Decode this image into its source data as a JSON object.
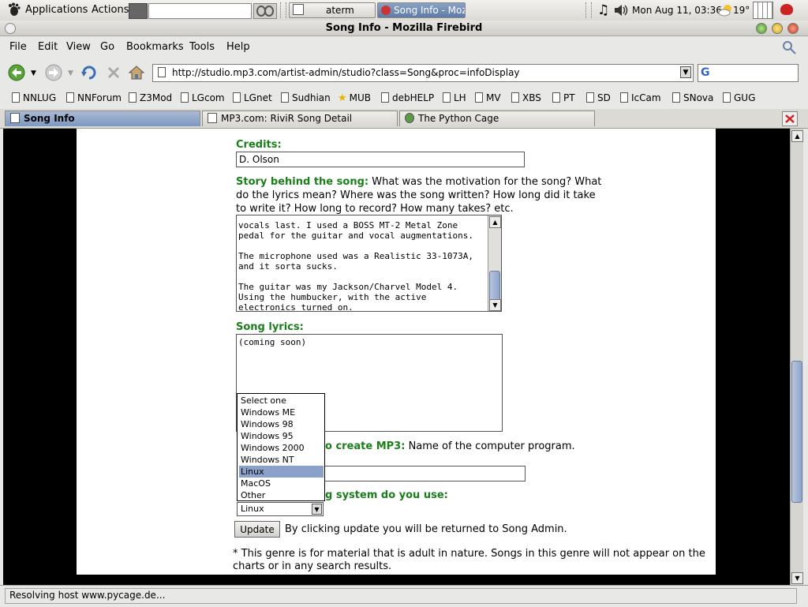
{
  "panel": {
    "applications": "Applications",
    "actions": "Actions",
    "tasks": [
      {
        "label": "aterm"
      },
      {
        "label": "Song Info - Moz"
      }
    ],
    "clock": "Mon Aug 11, 03:36",
    "weather": "19°"
  },
  "window": {
    "title": "Song Info - Mozilla Firebird"
  },
  "menubar": [
    "File",
    "Edit",
    "View",
    "Go",
    "Bookmarks",
    "Tools",
    "Help"
  ],
  "navigation": {
    "url": "http://studio.mp3.com/artist-admin/studio?class=Song&proc=infoDisplay",
    "search_value": "G"
  },
  "bookmarks": [
    "NNLUG",
    "NNForum",
    "Z3Mod",
    "LGcom",
    "LGnet",
    "Sudhian",
    "MUB",
    "debHELP",
    "LH",
    "MV",
    "XBS",
    "PT",
    "SD",
    "IcCam",
    "SNova",
    "GUG"
  ],
  "tabs": [
    {
      "label": "Song Info"
    },
    {
      "label": "MP3.com: RiviR Song Detail"
    },
    {
      "label": "The Python Cage"
    }
  ],
  "form": {
    "credits_label": "Credits:",
    "credits_value": "D. Olson",
    "story_label": "Story behind the song:",
    "story_help_line1": " What was the motivation for the song? What",
    "story_help_line2": "do the lyrics mean? Where was the song written? How long did it take",
    "story_help_line3": "to write it? How long to record? How many takes? etc.",
    "story_text": [
      "vocals last. I used a BOSS MT-2 Metal Zone",
      "pedal for the guitar and vocal augmentations.",
      "",
      "The microphone used was a Realistic 33-1073A,",
      "and it sorta sucks.",
      "",
      "The guitar was my Jackson/Charvel Model 4.",
      "Using the humbucker, with the active",
      "electronics turned on."
    ],
    "lyrics_label": "Song lyrics:",
    "lyrics_value": "(coming soon)",
    "software_label_visible": "o create MP3:",
    "software_help": " Name of the computer program.",
    "os_label_visible": "g system do you use:",
    "os_selected": "Linux",
    "os_options": [
      "Select one",
      "Windows ME",
      "Windows 98",
      "Windows 95",
      "Windows 2000",
      "Windows NT",
      "Linux",
      "MacOS",
      "Other"
    ],
    "update_button": "Update",
    "update_note": "By clicking update you will be returned to Song Admin.",
    "footnote_line1": "* This genre is for material that is adult in nature. Songs in this genre will not appear on the",
    "footnote_line2": "charts or in any search results."
  },
  "status": {
    "text": "Resolving host www.pycage.de..."
  },
  "colors": {
    "label_green": "#1a7f1a",
    "selection_blue": "#8aa1c9"
  }
}
